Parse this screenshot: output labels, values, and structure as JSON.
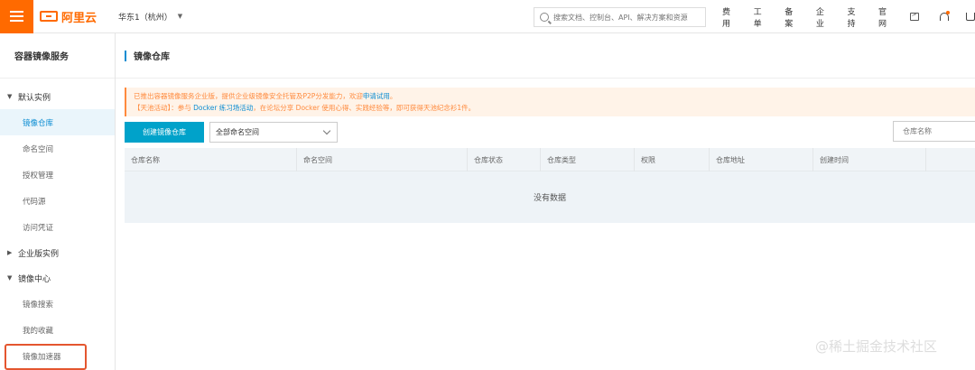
{
  "topbar": {
    "brand": "阿里云",
    "region": "华东1（杭州）",
    "search_placeholder": "搜索文档、控制台、API、解决方案和资源",
    "nav_items": [
      "费用",
      "工单",
      "备案",
      "企业",
      "支持",
      "官网"
    ]
  },
  "sidebar": {
    "title": "容器镜像服务",
    "groups": [
      {
        "label": "默认实例",
        "expanded": true,
        "items": [
          {
            "label": "镜像仓库",
            "active": true
          },
          {
            "label": "命名空间"
          },
          {
            "label": "授权管理"
          },
          {
            "label": "代码源"
          },
          {
            "label": "访问凭证"
          }
        ]
      },
      {
        "label": "企业版实例",
        "expanded": false,
        "items": []
      },
      {
        "label": "镜像中心",
        "expanded": true,
        "items": [
          {
            "label": "镜像搜索"
          },
          {
            "label": "我的收藏"
          },
          {
            "label": "镜像加速器",
            "highlighted": true
          }
        ]
      }
    ]
  },
  "main": {
    "title": "镜像仓库",
    "notice": {
      "line1_text": "已推出容器镜像服务企业版，提供企业级镜像安全托管及P2P分发能力，欢迎",
      "line1_link": "申请试用",
      "line1_end": "。",
      "line2_prefix": "【天池活动】：参与 ",
      "line2_link": "Docker 练习场活动",
      "line2_text": "，在论坛分享 Docker 使用心得、实践经验等，即可获得天池纪念衫1件。"
    },
    "create_button": "创建镜像仓库",
    "namespace_select": "全部命名空间",
    "repo_search_placeholder": "仓库名称",
    "columns": [
      "仓库名称",
      "命名空间",
      "仓库状态",
      "仓库类型",
      "权限",
      "仓库地址",
      "创建时间"
    ],
    "empty_text": "没有数据"
  },
  "watermark": "@稀土掘金技术社区",
  "colors": {
    "brand": "#ff6a00",
    "primary": "#00a2ca",
    "link": "#0a8cd2",
    "highlight_box": "#e4562f"
  }
}
